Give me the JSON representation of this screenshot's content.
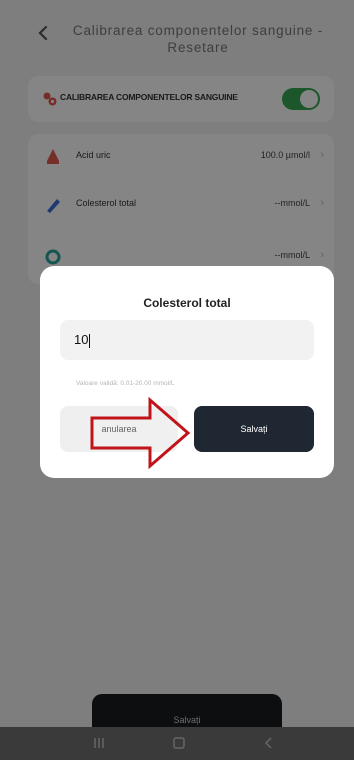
{
  "header": {
    "title": "Calibrarea componentelor sanguine - Resetare"
  },
  "calibration": {
    "label": "CALIBRAREA COMPONENTELOR SANGUINE",
    "enabled": true
  },
  "rows": [
    {
      "label": "Acid uric",
      "value": "100.0 µmol/l",
      "icon": "uric-acid-icon",
      "color": "#e05a4e"
    },
    {
      "label": "Colesterol total",
      "value": "--mmol/L",
      "icon": "cholesterol-icon",
      "color": "#3b6fd8"
    },
    {
      "label": "",
      "value": "--mmol/L",
      "icon": "lipid-icon",
      "color": "#2aa59a"
    }
  ],
  "dialog": {
    "title": "Colesterol total",
    "input_value": "10",
    "hint": "Valoare validă: 0.01-20.00 mmol/L",
    "cancel_label": "anularea",
    "save_label": "Salvați"
  },
  "bottom": {
    "save_label": "Salvați"
  },
  "colors": {
    "accent_green": "#34a853",
    "dark_button": "#1f2733",
    "arrow_red": "#c0141a"
  }
}
